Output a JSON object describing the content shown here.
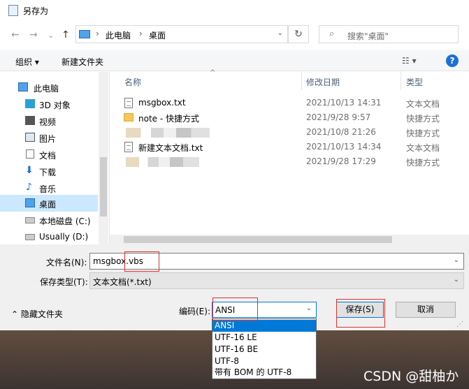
{
  "window": {
    "title": "另存为"
  },
  "nav": {
    "back": "←",
    "forward": "→",
    "recent": "⌄",
    "up": "↑",
    "refresh": "↻"
  },
  "address": {
    "segments": [
      "此电脑",
      "桌面"
    ],
    "separator": "›",
    "dropdown": "⌄"
  },
  "search": {
    "placeholder": "搜索\"桌面\"",
    "icon": "search-icon"
  },
  "toolbar": {
    "organize": "组织 ▾",
    "new_folder": "新建文件夹",
    "view": "☷ ▾",
    "help": "?"
  },
  "sidebar": {
    "items": [
      {
        "label": "此电脑",
        "icon": "computer-icon",
        "color": "#4fa3ea"
      },
      {
        "label": "3D 对象",
        "icon": "cube-icon",
        "color": "#2aa0d6"
      },
      {
        "label": "视频",
        "icon": "video-icon",
        "color": "#555555"
      },
      {
        "label": "图片",
        "icon": "picture-icon",
        "color": "#555555"
      },
      {
        "label": "文档",
        "icon": "document-icon",
        "color": "#777777"
      },
      {
        "label": "下载",
        "icon": "download-icon",
        "color": "#1e6fd9"
      },
      {
        "label": "音乐",
        "icon": "music-icon",
        "color": "#1e6fd9"
      },
      {
        "label": "桌面",
        "icon": "desktop-icon",
        "color": "#4fa3ea"
      },
      {
        "label": "本地磁盘 (C:)",
        "icon": "drive-icon",
        "color": "#888888"
      },
      {
        "label": "Usually (D:)",
        "icon": "drive-icon",
        "color": "#888888"
      }
    ]
  },
  "files": {
    "columns": [
      "名称",
      "修改日期",
      "类型"
    ],
    "sort_indicator": "^",
    "rows": [
      {
        "name": "msgbox.txt",
        "date": "2021/10/13 14:31",
        "type": "文本文档",
        "icon": "text-file-icon"
      },
      {
        "name": "note - 快捷方式",
        "date": "2021/9/28 9:57",
        "type": "快捷方式",
        "icon": "shortcut-icon"
      },
      {
        "name": "",
        "date": "2021/10/8 21:26",
        "type": "快捷方式",
        "icon": "blurred"
      },
      {
        "name": "新建文本文档.txt",
        "date": "2021/10/13 14:34",
        "type": "文本文档",
        "icon": "text-file-icon"
      },
      {
        "name": "",
        "date": "2021/9/28 17:29",
        "type": "快捷方式",
        "icon": "blurred"
      }
    ]
  },
  "form": {
    "filename_label": "文件名(N):",
    "filename_value": "msgbox.vbs",
    "type_label": "保存类型(T):",
    "type_value": "文本文档(*.txt)",
    "hide_folders": "隐藏文件夹",
    "encoding_label": "编码(E):",
    "encoding_value": "ANSI",
    "encoding_options": [
      "ANSI",
      "UTF-16 LE",
      "UTF-16 BE",
      "UTF-8",
      "带有 BOM 的 UTF-8"
    ],
    "save": "保存(S)",
    "cancel": "取消"
  },
  "watermark": "CSDN @甜柚か",
  "colors": {
    "accent": "#0078d7",
    "selection": "#cce8ff",
    "highlight_box": "#e0302a"
  }
}
